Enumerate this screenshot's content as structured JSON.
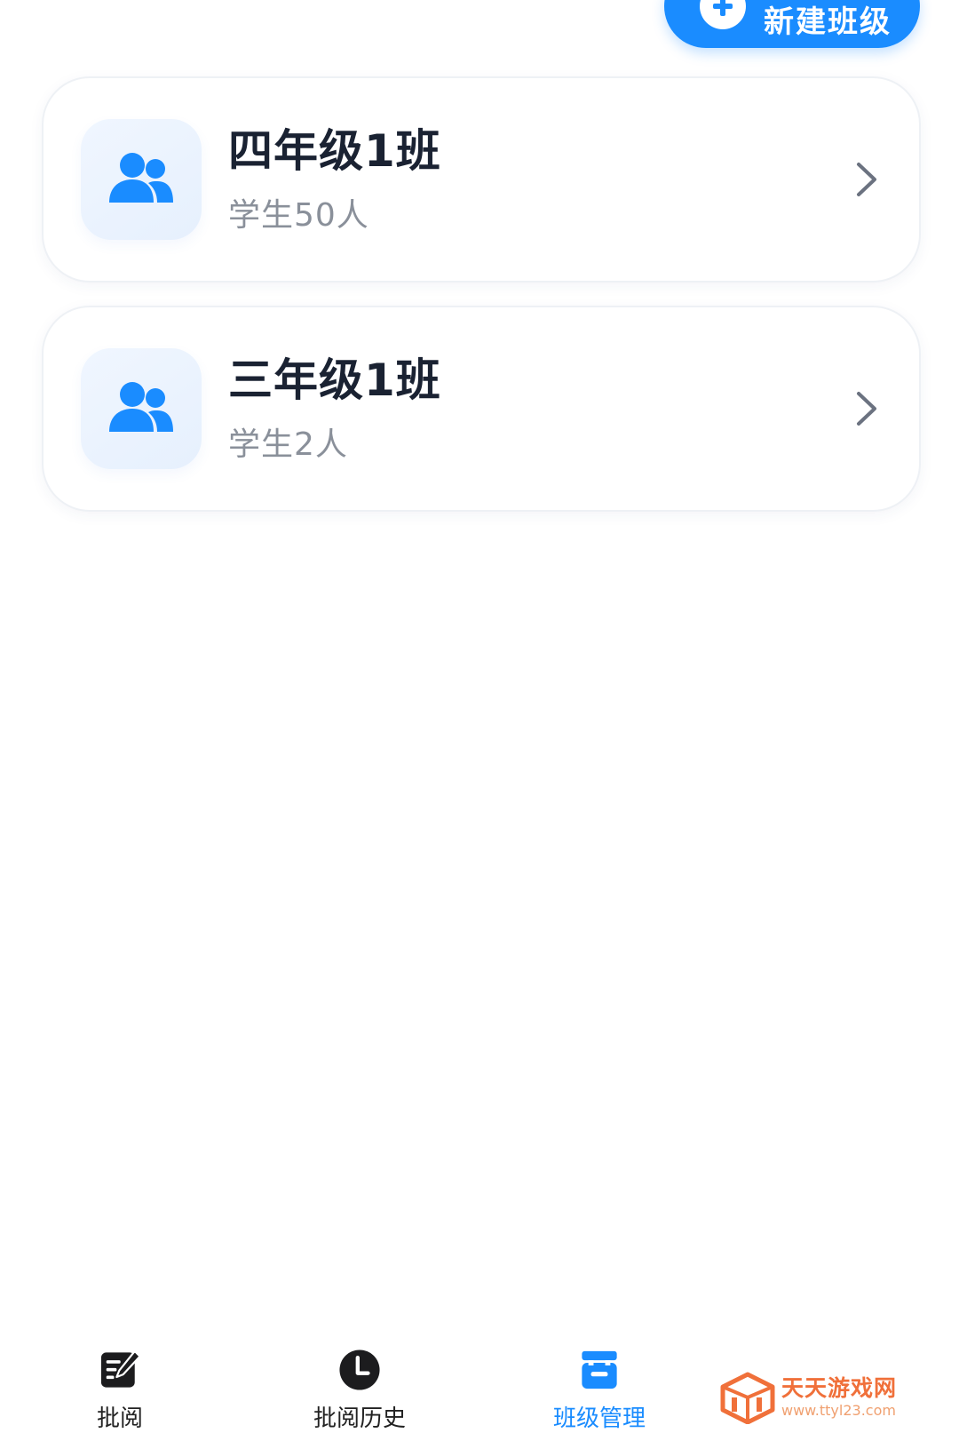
{
  "header": {
    "new_class_label": "新建班级"
  },
  "classes": [
    {
      "name": "四年级1班",
      "student_count": "学生50人"
    },
    {
      "name": "三年级1班",
      "student_count": "学生2人"
    }
  ],
  "tabs": [
    {
      "label": "批阅",
      "icon": "edit-document-icon",
      "active": false
    },
    {
      "label": "批阅历史",
      "icon": "clock-icon",
      "active": false
    },
    {
      "label": "班级管理",
      "icon": "class-manage-icon",
      "active": true
    }
  ],
  "watermark": {
    "title": "天天游戏网",
    "url": "www.ttyl23.com"
  },
  "colors": {
    "accent": "#1a8cff",
    "title_text": "#1a2232",
    "sub_text": "#8a909a",
    "watermark": "#f0703a"
  }
}
